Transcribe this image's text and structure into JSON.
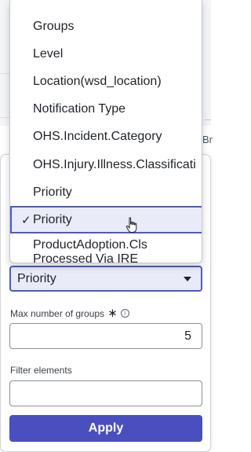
{
  "background": {
    "partial_text": "Br"
  },
  "dropdown": {
    "items": [
      {
        "label": "Groups",
        "selected": false
      },
      {
        "label": "Level",
        "selected": false
      },
      {
        "label": "Location(wsd_location)",
        "selected": false
      },
      {
        "label": "Notification Type",
        "selected": false
      },
      {
        "label": "OHS.Incident.Category",
        "selected": false
      },
      {
        "label": "OHS.Injury.Illness.Classificati",
        "selected": false
      },
      {
        "label": "Priority",
        "selected": false
      },
      {
        "label": "Priority",
        "selected": true
      },
      {
        "label": "ProductAdoption.Cls Processed Via IRE",
        "selected": false
      }
    ],
    "check_glyph": "✓"
  },
  "form": {
    "selected_value": "Priority",
    "max_groups": {
      "label": "Max number of groups",
      "required_mark": "∗",
      "info_glyph": "i",
      "value": "5"
    },
    "filter": {
      "label": "Filter elements",
      "value": ""
    },
    "apply_label": "Apply"
  },
  "colors": {
    "accent": "#4a4fbf",
    "selected_bg": "#e9ebf8",
    "selected_border": "#4f58c7"
  }
}
